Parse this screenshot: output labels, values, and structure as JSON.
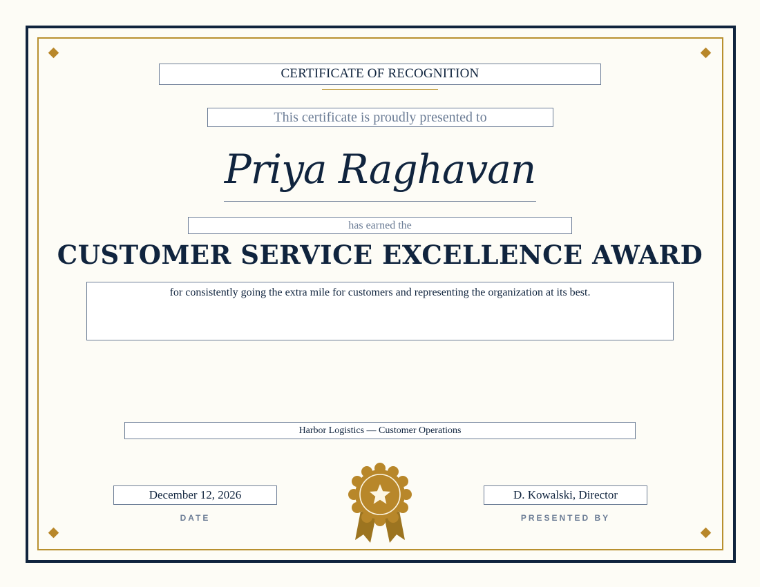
{
  "certificate": {
    "heading": "CERTIFICATE OF RECOGNITION",
    "presented_text": "This certificate is proudly presented to",
    "recipient_name": "Priya Raghavan",
    "earned_text": "has earned the",
    "award_title": "CUSTOMER SERVICE EXCELLENCE AWARD",
    "reason": "for consistently going the extra mile for customers and representing the organization at its best.",
    "organization": "Harbor Logistics — Customer Operations",
    "date": "December 12, 2026",
    "date_caption": "DATE",
    "signer": "D. Kowalski, Director",
    "signer_caption": "PRESENTED BY"
  },
  "icons": {
    "seal": "award-seal-star-icon",
    "corner": "diamond-ornament-icon"
  },
  "colors": {
    "navy": "#10243e",
    "gold": "#b8872a",
    "muted": "#6b7c95",
    "paper": "#fdfcf6"
  }
}
